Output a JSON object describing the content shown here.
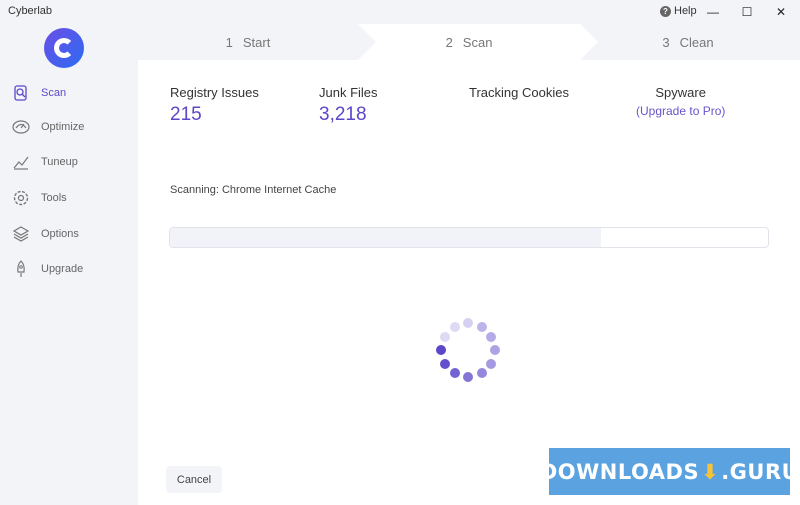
{
  "window": {
    "title": "Cyberlab",
    "help_label": "Help",
    "minimize": "—",
    "maximize": "☐",
    "close": "✕"
  },
  "sidebar": {
    "items": [
      {
        "label": "Scan",
        "icon": "scan-icon",
        "active": true
      },
      {
        "label": "Optimize",
        "icon": "optimize-icon",
        "active": false
      },
      {
        "label": "Tuneup",
        "icon": "tuneup-icon",
        "active": false
      },
      {
        "label": "Tools",
        "icon": "gear-icon",
        "active": false
      },
      {
        "label": "Options",
        "icon": "layers-icon",
        "active": false
      },
      {
        "label": "Upgrade",
        "icon": "rocket-icon",
        "active": false
      }
    ]
  },
  "steps": [
    {
      "num": "1",
      "label": "Start",
      "active": false
    },
    {
      "num": "2",
      "label": "Scan",
      "active": true
    },
    {
      "num": "3",
      "label": "Clean",
      "active": false
    }
  ],
  "stats": {
    "registry": {
      "label": "Registry Issues",
      "value": "215"
    },
    "junk": {
      "label": "Junk Files",
      "value": "3,218"
    },
    "cookies": {
      "label": "Tracking Cookies",
      "value": ""
    },
    "spyware": {
      "label": "Spyware",
      "link": "(Upgrade to Pro)"
    }
  },
  "scan": {
    "status": "Scanning: Chrome Internet Cache",
    "progress": 0.72
  },
  "cancel_label": "Cancel",
  "watermark": {
    "text_left": "DOWNLOADS",
    "text_right": ".GURU"
  },
  "colors": {
    "accent": "#5b47c9",
    "watermark_bg": "#5aa3e0"
  }
}
